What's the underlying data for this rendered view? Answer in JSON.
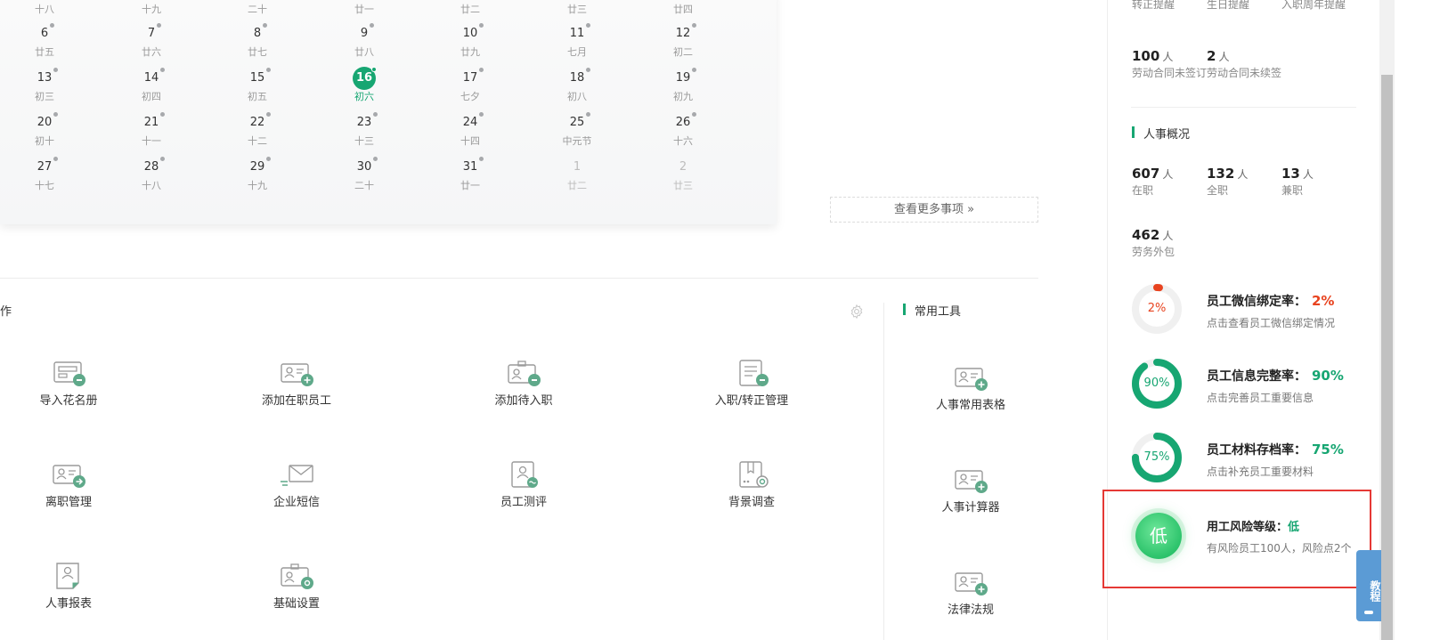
{
  "calendar": {
    "today_color": "#17a672",
    "rows": [
      [
        {
          "n": "6",
          "l": "廿五"
        },
        {
          "n": "7",
          "l": "廿六"
        },
        {
          "n": "8",
          "l": "廿七"
        },
        {
          "n": "9",
          "l": "廿八"
        },
        {
          "n": "10",
          "l": "廿九"
        },
        {
          "n": "11",
          "l": "七月"
        },
        {
          "n": "12",
          "l": "初二"
        }
      ],
      [
        {
          "n": "13",
          "l": "初三"
        },
        {
          "n": "14",
          "l": "初四"
        },
        {
          "n": "15",
          "l": "初五"
        },
        {
          "n": "16",
          "l": "初六"
        },
        {
          "n": "17",
          "l": "七夕"
        },
        {
          "n": "18",
          "l": "初八"
        },
        {
          "n": "19",
          "l": "初九"
        }
      ],
      [
        {
          "n": "20",
          "l": "初十"
        },
        {
          "n": "21",
          "l": "十一"
        },
        {
          "n": "22",
          "l": "十二"
        },
        {
          "n": "23",
          "l": "十三"
        },
        {
          "n": "24",
          "l": "十四"
        },
        {
          "n": "25",
          "l": "中元节"
        },
        {
          "n": "26",
          "l": "十六"
        }
      ],
      [
        {
          "n": "27",
          "l": "十七"
        },
        {
          "n": "28",
          "l": "十八"
        },
        {
          "n": "29",
          "l": "十九"
        },
        {
          "n": "30",
          "l": "二十"
        },
        {
          "n": "31",
          "l": "廿一"
        },
        {
          "n": "1",
          "l": "廿二"
        },
        {
          "n": "2",
          "l": "廿三"
        }
      ]
    ],
    "top_cut_lunar": [
      "十八",
      "十九",
      "二十",
      "廿一",
      "廿二",
      "廿三",
      "廿四"
    ],
    "today": "16",
    "more_button": "查看更多事项 »"
  },
  "quick_actions": {
    "title_fragment": "作",
    "items": [
      {
        "label": "导入花名册",
        "icon": "import-roster-icon"
      },
      {
        "label": "添加在职员工",
        "icon": "add-employee-icon"
      },
      {
        "label": "添加待入职",
        "icon": "add-pending-hire-icon"
      },
      {
        "label": "入职/转正管理",
        "icon": "onboarding-icon"
      },
      {
        "label": "离职管理",
        "icon": "resignation-icon"
      },
      {
        "label": "企业短信",
        "icon": "sms-icon"
      },
      {
        "label": "员工测评",
        "icon": "evaluation-icon"
      },
      {
        "label": "背景调查",
        "icon": "background-check-icon"
      },
      {
        "label": "人事报表",
        "icon": "hr-report-icon"
      },
      {
        "label": "基础设置",
        "icon": "settings-icon"
      }
    ]
  },
  "tools": {
    "title": "常用工具",
    "items": [
      {
        "label": "人事常用表格"
      },
      {
        "label": "人事计算器"
      },
      {
        "label": "法律法规"
      }
    ]
  },
  "right_panel": {
    "reminders_top": [
      {
        "text": "转正提醒"
      },
      {
        "text": "生日提醒"
      },
      {
        "text": "入职周年提醒"
      }
    ],
    "contracts": [
      {
        "value": "100",
        "unit": "人",
        "text": "劳动合同未签订"
      },
      {
        "value": "2",
        "unit": "人",
        "text": "劳动合同未续签"
      }
    ],
    "overview_title": "人事概况",
    "overview": [
      {
        "value": "607",
        "unit": "人",
        "text": "在职"
      },
      {
        "value": "132",
        "unit": "人",
        "text": "全职"
      },
      {
        "value": "13",
        "unit": "人",
        "text": "兼职"
      },
      {
        "value": "462",
        "unit": "人",
        "text": "劳务外包"
      }
    ],
    "rates": [
      {
        "title": "员工微信绑定率：",
        "pct": "2%",
        "value": 0.02,
        "desc": "点击查看员工微信绑定情况",
        "color": "#e8431f"
      },
      {
        "title": "员工信息完整率：",
        "pct": "90%",
        "value": 0.9,
        "desc": "点击完善员工重要信息",
        "color": "#17a672"
      },
      {
        "title": "员工材料存档率：",
        "pct": "75%",
        "value": 0.75,
        "desc": "点击补充员工重要材料",
        "color": "#17a672"
      }
    ],
    "risk": {
      "badge": "低",
      "title": "用工风险等级：",
      "level": "低",
      "desc": "有风险员工100人，风险点2个"
    }
  },
  "float_tab": {
    "label": "教程"
  }
}
